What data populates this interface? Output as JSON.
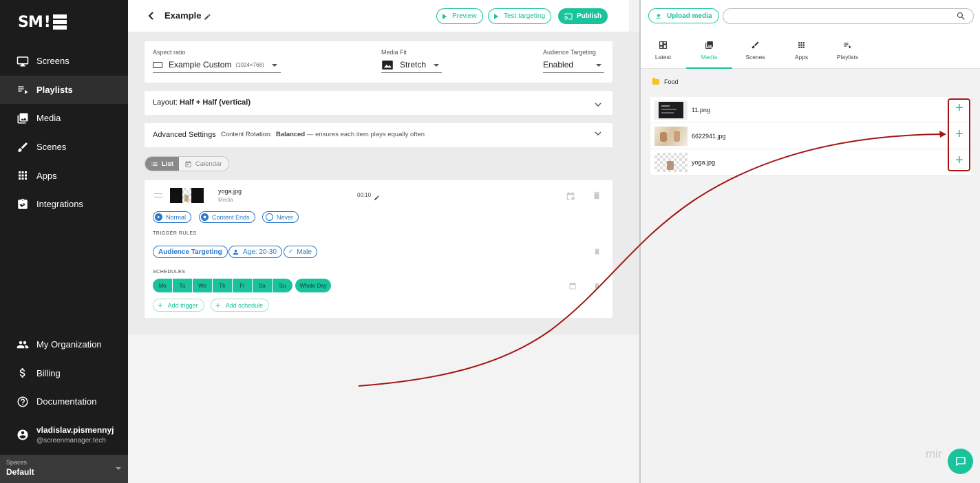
{
  "sidebar": {
    "logo": "SM",
    "items": [
      {
        "label": "Screens",
        "icon": "monitor-icon"
      },
      {
        "label": "Playlists",
        "icon": "playlist-icon",
        "active": true
      },
      {
        "label": "Media",
        "icon": "media-icon"
      },
      {
        "label": "Scenes",
        "icon": "brush-icon"
      },
      {
        "label": "Apps",
        "icon": "apps-grid-icon"
      },
      {
        "label": "Integrations",
        "icon": "integrations-icon"
      }
    ],
    "bottom_items": [
      {
        "label": "My Organization",
        "icon": "people-icon"
      },
      {
        "label": "Billing",
        "icon": "dollar-icon"
      },
      {
        "label": "Documentation",
        "icon": "help-icon"
      }
    ],
    "user": {
      "name": "vladislav.pismennyj",
      "email": "@screenmanager.tech"
    },
    "spaces": {
      "label": "Spaces",
      "value": "Default"
    }
  },
  "header": {
    "title": "Example",
    "preview_label": "Preview",
    "test_label": "Test targeting",
    "publish_label": "Publish"
  },
  "settings": {
    "aspect_label": "Aspect ratio",
    "aspect_value": "Example Custom",
    "aspect_size": "(1024×768)",
    "fit_label": "Media Fit",
    "fit_value": "Stretch",
    "audience_label": "Audience Targeting",
    "audience_value": "Enabled"
  },
  "layout": {
    "prefix": "Layout:",
    "value": "Half + Half (vertical)"
  },
  "advanced": {
    "title": "Advanced Settings",
    "rotation_label": "Content Rotation:",
    "rotation_value": "Balanced",
    "rotation_desc": "— ensures each item plays equally often"
  },
  "view_toggle": {
    "list": "List",
    "calendar": "Calendar"
  },
  "item": {
    "name": "yoga.jpg",
    "type": "Media",
    "duration": "00:10",
    "chips": [
      "Normal",
      "Content Ends",
      "Never"
    ],
    "trigger_rules_label": "TRIGGER RULES",
    "audience_chip": "Audience Targeting",
    "age_chip": "Age: 20-30",
    "gender_chip": "Male",
    "schedules_label": "SCHEDULES",
    "days": [
      "Mo",
      "Tu",
      "We",
      "Th",
      "Fr",
      "Sa",
      "Su"
    ],
    "whole_day": "Whole Day",
    "add_trigger": "Add trigger",
    "add_schedule": "Add schedule"
  },
  "library": {
    "upload_label": "Upload media",
    "search_placeholder": "",
    "tabs": [
      {
        "label": "Latest",
        "icon": "dashboard-icon"
      },
      {
        "label": "Media",
        "icon": "image-gallery-icon",
        "active": true
      },
      {
        "label": "Scenes",
        "icon": "brush-icon"
      },
      {
        "label": "Apps",
        "icon": "apps-grid-icon"
      },
      {
        "label": "Playlists",
        "icon": "playlist-icon"
      }
    ],
    "folder": "Food",
    "files": [
      {
        "name": "11.png"
      },
      {
        "name": "6622941.jpg"
      },
      {
        "name": "yoga.jpg"
      }
    ]
  },
  "watermark": "mir",
  "colors": {
    "accent": "#19c39b",
    "chip_blue": "#2b77c9",
    "annotation_red": "#a31515",
    "sidebar_bg": "#1c1c1c"
  }
}
